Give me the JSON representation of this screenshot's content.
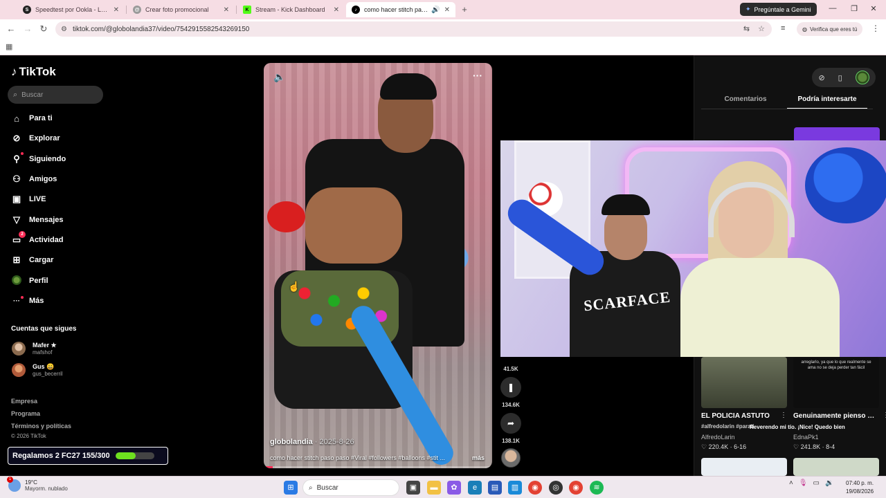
{
  "browser": {
    "tabs": [
      {
        "label": "Speedtest por Ookla - La prueba de",
        "icon_color": "#222222",
        "icon": "S"
      },
      {
        "label": "Crear foto promocional",
        "icon_color": "#9a9a9a",
        "icon": "@"
      },
      {
        "label": "Stream - Kick Dashboard",
        "icon_color": "#53fc18",
        "icon": "K"
      },
      {
        "label": "como hacer stitch paso pas",
        "icon_color": "#000000",
        "icon": "♪"
      }
    ],
    "gemini_label": "Pregúntale a Gemini",
    "url": "tiktok.com/@globolandia37/video/7542915582543269150",
    "verify_label": "Verifica que eres tú"
  },
  "tiktok": {
    "logo": "TikTok",
    "search_placeholder": "Buscar",
    "nav": [
      {
        "label": "Para ti",
        "icon": "home-icon",
        "glyph": "⌂"
      },
      {
        "label": "Explorar",
        "icon": "compass-icon",
        "glyph": "⊘"
      },
      {
        "label": "Siguiendo",
        "icon": "following-icon",
        "glyph": "⚇"
      },
      {
        "label": "Amigos",
        "icon": "friends-icon",
        "glyph": "⚇"
      },
      {
        "label": "LIVE",
        "icon": "live-icon",
        "glyph": "▣"
      },
      {
        "label": "Mensajes",
        "icon": "messages-icon",
        "glyph": "▽"
      },
      {
        "label": "Actividad",
        "icon": "activity-icon",
        "glyph": "▭",
        "badge": "2"
      },
      {
        "label": "Cargar",
        "icon": "upload-icon",
        "glyph": "⊞"
      },
      {
        "label": "Perfil",
        "icon": "profile-icon",
        "glyph": "●"
      },
      {
        "label": "Más",
        "icon": "more-icon",
        "glyph": "···"
      }
    ],
    "following_title": "Cuentas que sigues",
    "following": [
      {
        "name": "Mafer ★",
        "handle": "mafshof",
        "avatar_color": "#b07a5a"
      },
      {
        "name": "Gus 😄",
        "handle": "gus_becerril",
        "avatar_color": "#c0704a"
      }
    ],
    "footer_links": [
      "Empresa",
      "Programa",
      "Términos y políticas"
    ],
    "copyright": "© 2026 TikTok",
    "promo": {
      "text": "Regalamos 2 FC27 155/300",
      "progress": 0.52
    }
  },
  "video": {
    "author": "globolandia",
    "date": "· 2025-8-26",
    "caption": "como hacer stitch paso paso #Viral #followers #balloons #stit ...",
    "more_label": "más",
    "progress": 0.04,
    "actions": [
      {
        "name": "comments",
        "count": "41.5K",
        "glyph": "…"
      },
      {
        "name": "bookmark",
        "count": "134.6K",
        "glyph": "❚"
      },
      {
        "name": "share",
        "count": "138.1K",
        "glyph": "➦"
      }
    ]
  },
  "overlay": {
    "shirt_text": "SCARFACE"
  },
  "right_panel": {
    "tabs": [
      "Comentarios",
      "Podría interesarte"
    ],
    "cards": [
      {
        "title": "EL POLICIA ASTUTO",
        "subtitle": "#alfredolarin #parati",
        "author": "AlfredoLarin",
        "stats": "♡ 220.4K · 6-16",
        "thumb_color": "#2e3a2a"
      },
      {
        "title": "Genuinamente pienso que merezco",
        "subtitle": "Reverendo mi tío. ¡Nice! Quedo bien",
        "author": "EdnaPk1",
        "stats": "♡ 241.8K · 8-4",
        "thumb_color": "#1a1a1a",
        "thumb_text": "arreglarlo, ya que lo que realmente se ama no se deja perder tan fácil"
      }
    ]
  },
  "taskbar": {
    "weather_temp": "19°C",
    "weather_desc": "Mayorm. nublado",
    "weather_badge": "1",
    "search_label": "Buscar",
    "time": "07:40 p. m.",
    "date": "19/08/2026"
  }
}
